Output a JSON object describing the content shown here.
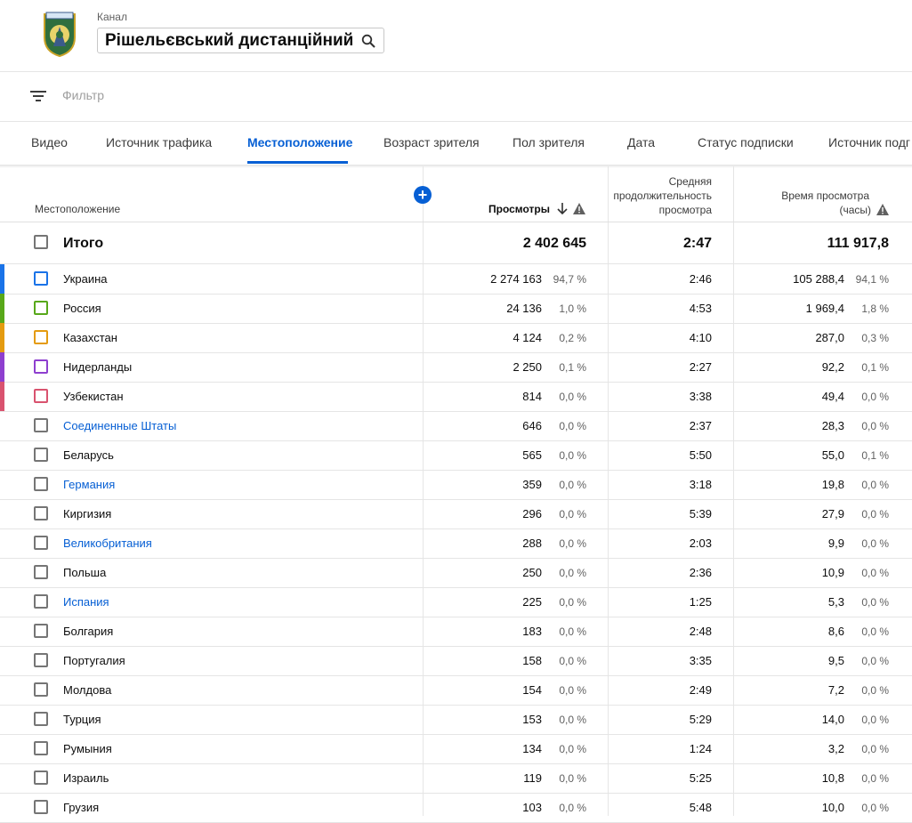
{
  "header": {
    "channel_caption": "Канал",
    "channel_name": "Рішельєвський дистанційний",
    "logo_icon": "channel-logo-icon"
  },
  "filter": {
    "placeholder": "Фильтр",
    "icon": "filter-icon"
  },
  "tabs": [
    {
      "label": "Видео",
      "active": false
    },
    {
      "label": "Источник трафика",
      "active": false
    },
    {
      "label": "Местоположение",
      "active": true
    },
    {
      "label": "Возраст зрителя",
      "active": false
    },
    {
      "label": "Пол зрителя",
      "active": false
    },
    {
      "label": "Дата",
      "active": false
    },
    {
      "label": "Статус подписки",
      "active": false
    },
    {
      "label": "Источник подг",
      "active": false
    }
  ],
  "columns": {
    "location": "Местоположение",
    "views": "Просмотры",
    "avg_duration_1": "Средняя",
    "avg_duration_2": "продолжительность",
    "avg_duration_3": "просмотра",
    "watch_time_1": "Время просмотра",
    "watch_time_2": "(часы)"
  },
  "colors": {
    "accent": "#065fd4",
    "series": [
      "#1a73e8",
      "#58a81a",
      "#e49b10",
      "#8e3fcf",
      "#d9536f"
    ]
  },
  "total": {
    "label": "Итого",
    "views": "2 402 645",
    "avg": "2:47",
    "hours": "111 917,8"
  },
  "rows": [
    {
      "name": "Украина",
      "views": "2 274 163",
      "views_pct": "94,7 %",
      "avg": "2:46",
      "hours": "105 288,4",
      "hours_pct": "94,1 %",
      "link": false,
      "color": "#1a73e8"
    },
    {
      "name": "Россия",
      "views": "24 136",
      "views_pct": "1,0 %",
      "avg": "4:53",
      "hours": "1 969,4",
      "hours_pct": "1,8 %",
      "link": false,
      "color": "#58a81a"
    },
    {
      "name": "Казахстан",
      "views": "4 124",
      "views_pct": "0,2 %",
      "avg": "4:10",
      "hours": "287,0",
      "hours_pct": "0,3 %",
      "link": false,
      "color": "#e49b10"
    },
    {
      "name": "Нидерланды",
      "views": "2 250",
      "views_pct": "0,1 %",
      "avg": "2:27",
      "hours": "92,2",
      "hours_pct": "0,1 %",
      "link": false,
      "color": "#8e3fcf"
    },
    {
      "name": "Узбекистан",
      "views": "814",
      "views_pct": "0,0 %",
      "avg": "3:38",
      "hours": "49,4",
      "hours_pct": "0,0 %",
      "link": false,
      "color": "#d9536f"
    },
    {
      "name": "Соединенные Штаты",
      "views": "646",
      "views_pct": "0,0 %",
      "avg": "2:37",
      "hours": "28,3",
      "hours_pct": "0,0 %",
      "link": true,
      "color": ""
    },
    {
      "name": "Беларусь",
      "views": "565",
      "views_pct": "0,0 %",
      "avg": "5:50",
      "hours": "55,0",
      "hours_pct": "0,1 %",
      "link": false,
      "color": ""
    },
    {
      "name": "Германия",
      "views": "359",
      "views_pct": "0,0 %",
      "avg": "3:18",
      "hours": "19,8",
      "hours_pct": "0,0 %",
      "link": true,
      "color": ""
    },
    {
      "name": "Киргизия",
      "views": "296",
      "views_pct": "0,0 %",
      "avg": "5:39",
      "hours": "27,9",
      "hours_pct": "0,0 %",
      "link": false,
      "color": ""
    },
    {
      "name": "Великобритания",
      "views": "288",
      "views_pct": "0,0 %",
      "avg": "2:03",
      "hours": "9,9",
      "hours_pct": "0,0 %",
      "link": true,
      "color": ""
    },
    {
      "name": "Польша",
      "views": "250",
      "views_pct": "0,0 %",
      "avg": "2:36",
      "hours": "10,9",
      "hours_pct": "0,0 %",
      "link": false,
      "color": ""
    },
    {
      "name": "Испания",
      "views": "225",
      "views_pct": "0,0 %",
      "avg": "1:25",
      "hours": "5,3",
      "hours_pct": "0,0 %",
      "link": true,
      "color": ""
    },
    {
      "name": "Болгария",
      "views": "183",
      "views_pct": "0,0 %",
      "avg": "2:48",
      "hours": "8,6",
      "hours_pct": "0,0 %",
      "link": false,
      "color": ""
    },
    {
      "name": "Португалия",
      "views": "158",
      "views_pct": "0,0 %",
      "avg": "3:35",
      "hours": "9,5",
      "hours_pct": "0,0 %",
      "link": false,
      "color": ""
    },
    {
      "name": "Молдова",
      "views": "154",
      "views_pct": "0,0 %",
      "avg": "2:49",
      "hours": "7,2",
      "hours_pct": "0,0 %",
      "link": false,
      "color": ""
    },
    {
      "name": "Турция",
      "views": "153",
      "views_pct": "0,0 %",
      "avg": "5:29",
      "hours": "14,0",
      "hours_pct": "0,0 %",
      "link": false,
      "color": ""
    },
    {
      "name": "Румыния",
      "views": "134",
      "views_pct": "0,0 %",
      "avg": "1:24",
      "hours": "3,2",
      "hours_pct": "0,0 %",
      "link": false,
      "color": ""
    },
    {
      "name": "Израиль",
      "views": "119",
      "views_pct": "0,0 %",
      "avg": "5:25",
      "hours": "10,8",
      "hours_pct": "0,0 %",
      "link": false,
      "color": ""
    },
    {
      "name": "Грузия",
      "views": "103",
      "views_pct": "0,0 %",
      "avg": "5:48",
      "hours": "10,0",
      "hours_pct": "0,0 %",
      "link": false,
      "color": ""
    }
  ]
}
